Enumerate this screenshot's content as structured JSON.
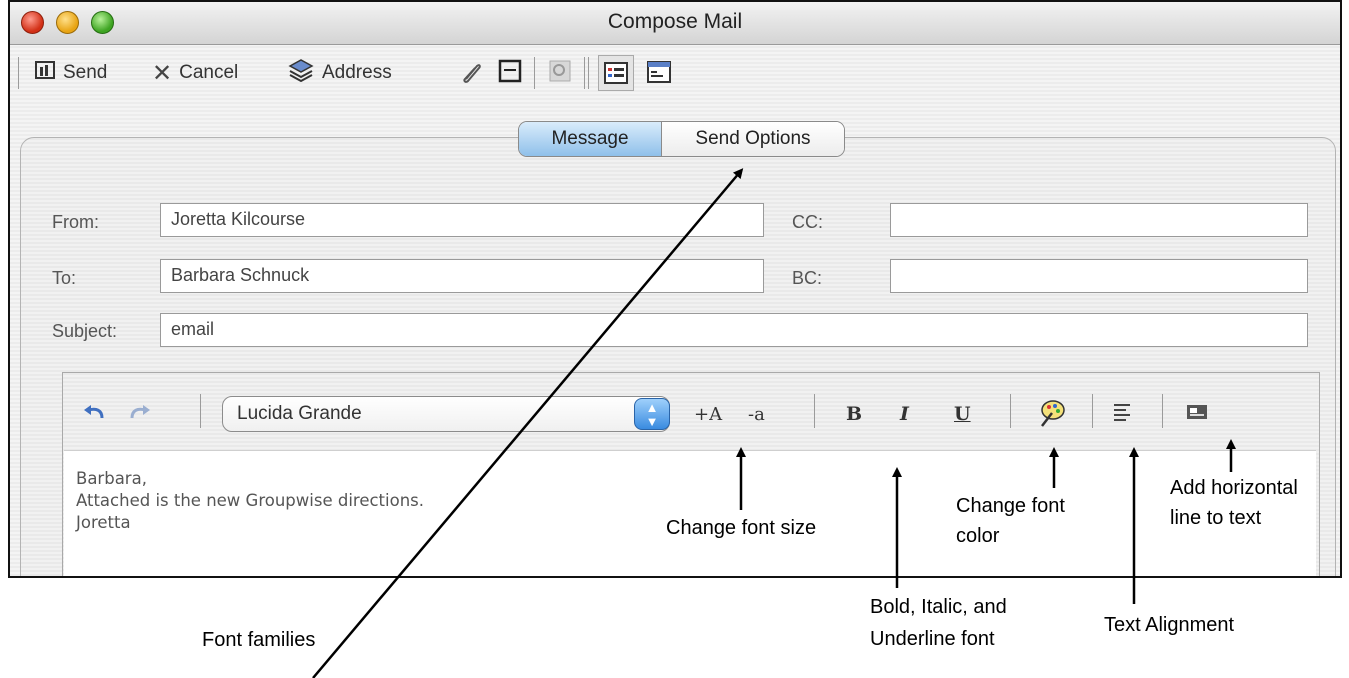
{
  "window": {
    "title": "Compose Mail"
  },
  "toolbar": {
    "send": {
      "label": "Send",
      "icon": "send-icon"
    },
    "cancel": {
      "label": "Cancel",
      "icon": "cancel-x-icon"
    },
    "address": {
      "label": "Address",
      "icon": "address-book-icon"
    }
  },
  "tabs": {
    "message": "Message",
    "send_options": "Send Options"
  },
  "fields": {
    "from_label": "From:",
    "from_value": "Joretta Kilcourse",
    "to_label": "To:",
    "to_value": "Barbara Schnuck",
    "subject_label": "Subject:",
    "subject_value": "email",
    "cc_label": "CC:",
    "cc_value": "",
    "bc_label": "BC:",
    "bc_value": ""
  },
  "editor": {
    "font_family": "Lucida Grande",
    "increase_size": "+A",
    "decrease_size": "-a",
    "bold": "B",
    "italic": "I",
    "underline": "U"
  },
  "message_body": [
    "Barbara,",
    "Attached is the new Groupwise directions.",
    "Joretta"
  ],
  "annotations": {
    "change_font_size": "Change font size",
    "change_font_color_1": "Change font",
    "change_font_color_2": "color",
    "add_line_1": "Add horizontal",
    "add_line_2": "line to text",
    "bold_italic_1": "Bold, Italic, and",
    "bold_italic_2": "Underline font",
    "text_alignment": "Text Alignment",
    "font_families": "Font families"
  },
  "colors": {
    "tab_active": "#8fc0ea",
    "stepper": "#3a8be0"
  }
}
